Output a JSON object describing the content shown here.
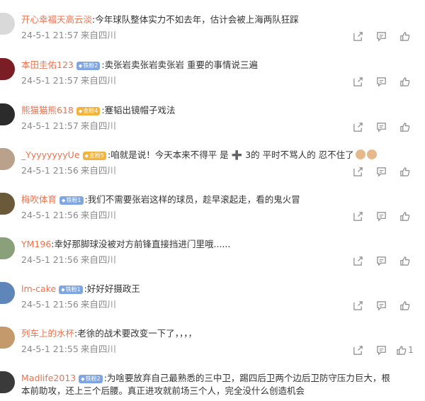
{
  "comments": [
    {
      "user": "开心幸福天高云淡",
      "badge": null,
      "text": ":今年球队整体实力不如去年，估计会被上海两队狂踩",
      "date": "24-5-1 21:57",
      "source": "来自四川",
      "avatar_color": "#d6d6d6",
      "likes": ""
    },
    {
      "user": "本田圭佑123",
      "badge": {
        "type": "iron",
        "label": "铁粉2"
      },
      "text": ":卖张岩卖张岩卖张岩  重要的事情说三遍",
      "date": "24-5-1 21:57",
      "source": "来自四川",
      "avatar_color": "#7a1d24",
      "likes": ""
    },
    {
      "user": "熊猫猫熊618",
      "badge": {
        "type": "gold",
        "label": "金粉4"
      },
      "text": ":蹇韬出镜帽子戏法",
      "date": "24-5-1 21:57",
      "source": "来自四川",
      "avatar_color": "#2b2b2b",
      "likes": ""
    },
    {
      "user": "_YyyyyyyyUe",
      "badge": {
        "type": "gold",
        "label": "金粉5"
      },
      "text": ":咱就是说！今天本来不得平 是 ➕ 3的 平时不骂人的 忍不住了",
      "date": "24-5-1 21:56",
      "source": "来自四川",
      "avatar_color": "#b9a18b",
      "likes": ""
    },
    {
      "user": "梅吹体育",
      "badge": {
        "type": "iron",
        "label": "铁粉1"
      },
      "text": ":我们不需要张岩这样的球员，趁早滚起走，看的鬼火冒",
      "date": "24-5-1 21:56",
      "source": "来自四川",
      "avatar_color": "#6b5a3a",
      "likes": ""
    },
    {
      "user": "YM196",
      "badge": null,
      "text": ":幸好那脚球没被对方前锋直接挡进门里哦......",
      "date": "24-5-1 21:56",
      "source": "来自四川",
      "avatar_color": "#8aa07a",
      "likes": ""
    },
    {
      "user": "lm-cake",
      "badge": {
        "type": "iron",
        "label": "铁粉1"
      },
      "text": ":好好好摄政王",
      "date": "24-5-1 21:56",
      "source": "来自四川",
      "avatar_color": "#5f86b8",
      "likes": ""
    },
    {
      "user": "列车上的水杯",
      "badge": null,
      "text": ":老徐的战术要改变一下了，，，，",
      "date": "24-5-1 21:55",
      "source": "来自四川",
      "avatar_color": "#c49a6c",
      "likes": "1"
    },
    {
      "user": "Madlife2013",
      "badge": {
        "type": "iron",
        "label": "铁粉2"
      },
      "text": ":为啥要放弃自己最熟悉的三中卫，踢四后卫两个边后卫防守压力巨大，根",
      "text2": "本前助攻，还上三个后腰。真正进攻就前场三个人，完全没什么创造机会",
      "date": "",
      "source": "",
      "avatar_color": "#3a3a3a",
      "likes": ""
    }
  ],
  "actions": {
    "forward": "forward-icon",
    "comment": "comment-icon",
    "like": "like-icon"
  }
}
